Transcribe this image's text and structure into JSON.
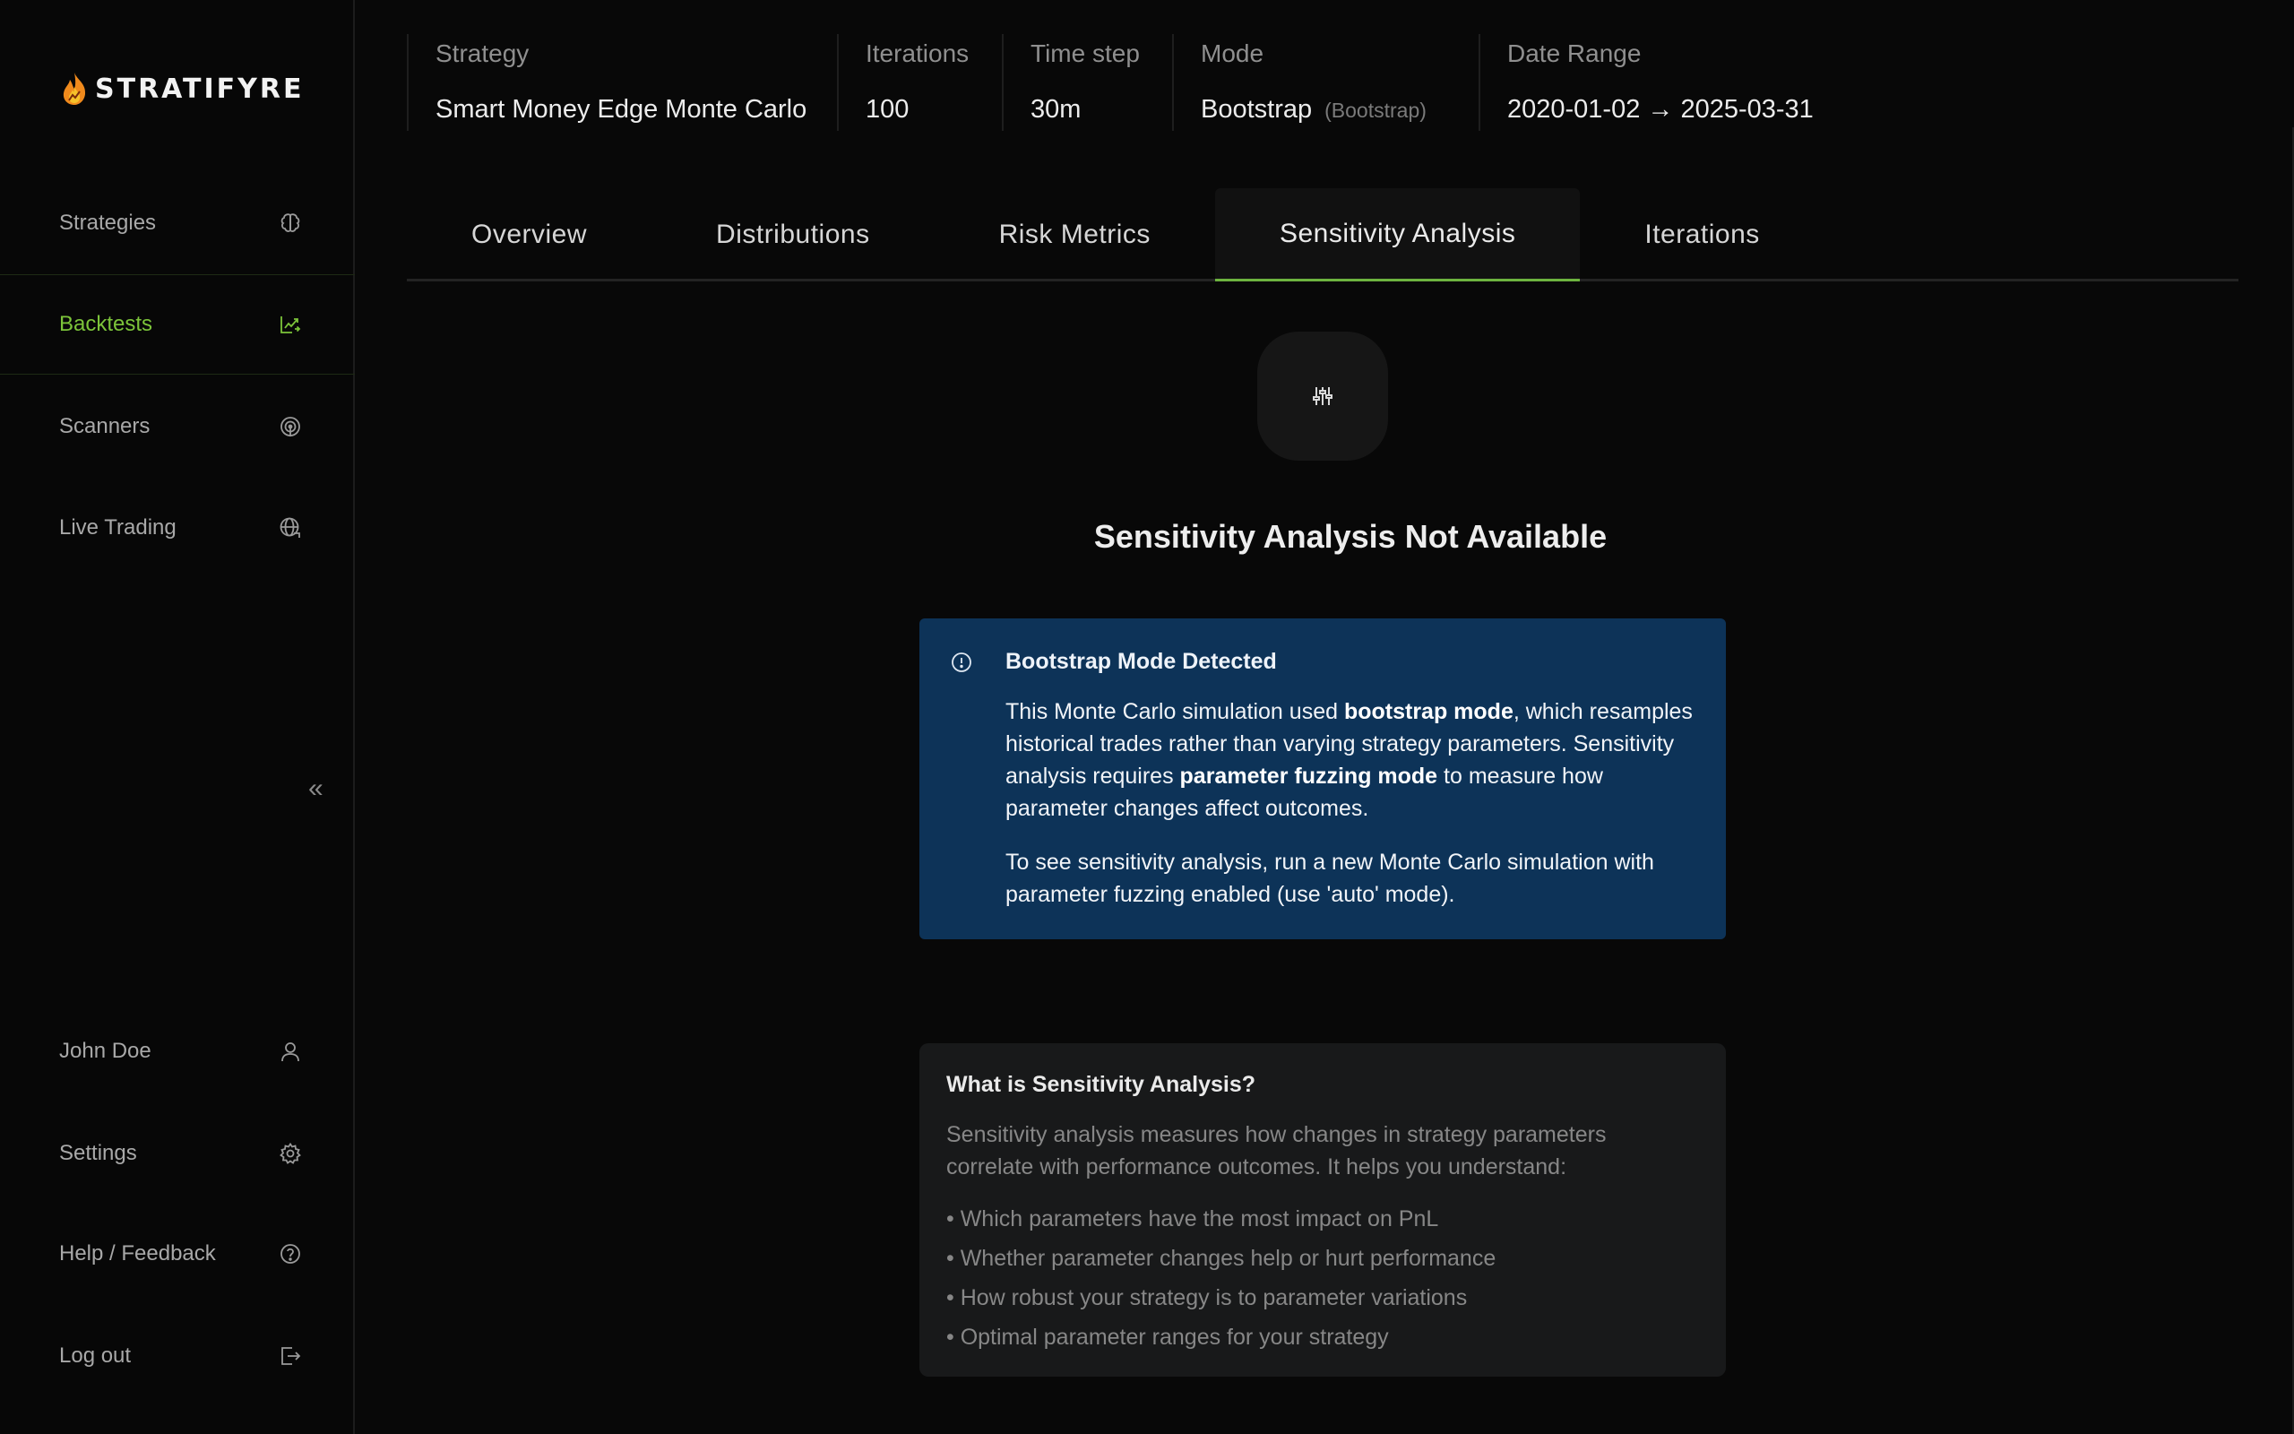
{
  "brand": {
    "name": "STRATIFYRE",
    "accent": "#7cc43a"
  },
  "sidebar": {
    "items": [
      {
        "label": "Strategies",
        "icon": "brain-icon"
      },
      {
        "label": "Backtests",
        "icon": "backtest-chart-icon",
        "active": true
      },
      {
        "label": "Scanners",
        "icon": "radar-icon"
      },
      {
        "label": "Live Trading",
        "icon": "globe-icon"
      }
    ],
    "bottom": [
      {
        "label": "John Doe",
        "icon": "user-icon"
      },
      {
        "label": "Settings",
        "icon": "gear-icon"
      },
      {
        "label": "Help / Feedback",
        "icon": "help-icon"
      },
      {
        "label": "Log out",
        "icon": "logout-icon"
      }
    ],
    "collapse_glyph": "«"
  },
  "header": {
    "strategy": {
      "label": "Strategy",
      "value": "Smart Money Edge Monte Carlo"
    },
    "iterations": {
      "label": "Iterations",
      "value": "100"
    },
    "timestep": {
      "label": "Time step",
      "value": "30m"
    },
    "mode": {
      "label": "Mode",
      "value": "Bootstrap",
      "sub": "(Bootstrap)"
    },
    "daterange": {
      "label": "Date Range",
      "value": "2020-01-02 → 2025-03-31"
    }
  },
  "tabs": [
    "Overview",
    "Distributions",
    "Risk Metrics",
    "Sensitivity Analysis",
    "Iterations"
  ],
  "active_tab": "Sensitivity Analysis",
  "main": {
    "title": "Sensitivity Analysis Not Available",
    "info": {
      "heading": "Bootstrap Mode Detected",
      "p1_a": "This Monte Carlo simulation used ",
      "p1_b": "bootstrap mode",
      "p1_c": ", which resamples historical trades rather than varying strategy parameters. Sensitivity analysis requires ",
      "p1_d": "parameter fuzzing mode",
      "p1_e": " to measure how parameter changes affect outcomes.",
      "p2": "To see sensitivity analysis, run a new Monte Carlo simulation with parameter fuzzing enabled (use 'auto' mode)."
    },
    "what": {
      "heading": "What is Sensitivity Analysis?",
      "desc": "Sensitivity analysis measures how changes in strategy parameters correlate with performance outcomes. It helps you understand:",
      "bullets": [
        "• Which parameters have the most impact on PnL",
        "• Whether parameter changes help or hurt performance",
        "• How robust your strategy is to parameter variations",
        "• Optimal parameter ranges for your strategy"
      ]
    }
  }
}
